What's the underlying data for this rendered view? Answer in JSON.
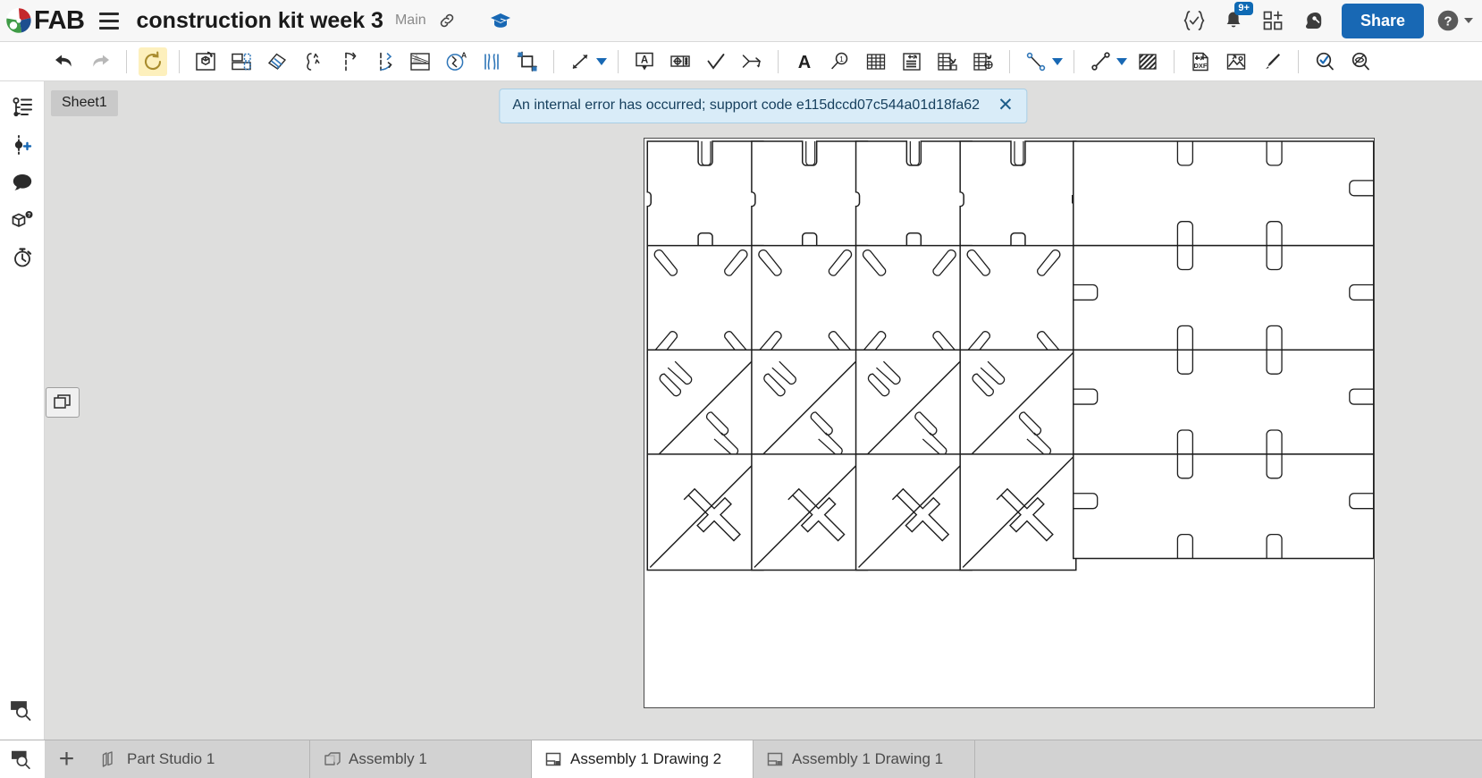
{
  "app": {
    "brand_text": "FAB",
    "document_title": "construction kit week 3",
    "branch": "Main"
  },
  "topbar": {
    "hamburger_name": "menu",
    "link_label": "link-icon",
    "learning_center": "graduation-cap-icon",
    "feature_script_label": "{✓}",
    "notification_badge": "9+",
    "share_label": "Share",
    "help_label": "?"
  },
  "toolbar": {
    "items": [
      {
        "name": "undo-button",
        "label": "Undo"
      },
      {
        "name": "redo-button",
        "label": "Redo"
      },
      {
        "name": "update-views-button",
        "label": "Update all views"
      },
      {
        "name": "insert-view-button",
        "label": "Insert view"
      },
      {
        "name": "projected-view-button",
        "label": "Projected view"
      },
      {
        "name": "section-view-button",
        "label": "Section view"
      },
      {
        "name": "broken-out-section-button",
        "label": "Broken-out section"
      },
      {
        "name": "break-view-button",
        "label": "Break view"
      },
      {
        "name": "detail-section-button",
        "label": "Detail section"
      },
      {
        "name": "detail-view-button",
        "label": "Detail view"
      },
      {
        "name": "crop-view-button",
        "label": "Crop view"
      },
      {
        "name": "dimension-button",
        "label": "Dimension"
      },
      {
        "name": "dimension-dropdown",
        "label": "Dimension options"
      },
      {
        "name": "note-button",
        "label": "Note"
      },
      {
        "name": "geometric-tolerance-button",
        "label": "Geometric tolerance"
      },
      {
        "name": "surface-finish-button",
        "label": "Surface finish"
      },
      {
        "name": "weld-symbol-button",
        "label": "Weld symbol"
      },
      {
        "name": "text-button",
        "label": "Text"
      },
      {
        "name": "balloon-button",
        "label": "Balloon"
      },
      {
        "name": "table-button",
        "label": "Table"
      },
      {
        "name": "bom-table-button",
        "label": "Bill of materials"
      },
      {
        "name": "revision-table-button",
        "label": "Revision table"
      },
      {
        "name": "hole-table-button",
        "label": "Hole table"
      },
      {
        "name": "sketch-point-line-button",
        "label": "Sketch entities"
      },
      {
        "name": "sketch-dropdown",
        "label": "Sketch options"
      },
      {
        "name": "line-button",
        "label": "Line"
      },
      {
        "name": "line-dropdown",
        "label": "Line options"
      },
      {
        "name": "hatch-button",
        "label": "Area hatch / fill"
      },
      {
        "name": "import-dxf-button",
        "label": "Import DXF"
      },
      {
        "name": "insert-image-button",
        "label": "Insert image"
      },
      {
        "name": "format-painter-button",
        "label": "Format painter"
      },
      {
        "name": "show-hidden-button",
        "label": "Show/hide"
      },
      {
        "name": "hide-button",
        "label": "Hide"
      }
    ]
  },
  "rail": {
    "items": [
      {
        "name": "sidebar-item-drawing-tree",
        "label": "Drawing properties"
      },
      {
        "name": "sidebar-item-insert-branch",
        "label": "Insert branch"
      },
      {
        "name": "sidebar-item-comments",
        "label": "Comments"
      },
      {
        "name": "sidebar-item-parts-list",
        "label": "Parts"
      },
      {
        "name": "sidebar-item-history",
        "label": "History"
      }
    ],
    "bottom_item": {
      "name": "sidebar-item-search",
      "label": "Search"
    }
  },
  "canvas": {
    "sheet_tab_label": "Sheet1",
    "layers_button_label": "Layers",
    "error": {
      "message": "An internal error has occurred; support code e115dccd07c544a01d18fa62",
      "close_label": "✕"
    }
  },
  "tabs": {
    "add_label": "+",
    "items": [
      {
        "label": "Part Studio 1",
        "icon": "part-studio-icon",
        "active": false
      },
      {
        "label": "Assembly 1",
        "icon": "assembly-icon",
        "active": false
      },
      {
        "label": "Assembly 1 Drawing 2",
        "icon": "drawing-icon",
        "active": true
      },
      {
        "label": "Assembly 1 Drawing 1",
        "icon": "drawing-icon",
        "active": false
      }
    ]
  },
  "colors": {
    "accent_blue": "#1868b4",
    "banner_bg": "#d9ecf8",
    "canvas_bg": "#dededd",
    "sheet_bg": "#ffffff",
    "highlight_yellow": "#fdf0bd"
  }
}
